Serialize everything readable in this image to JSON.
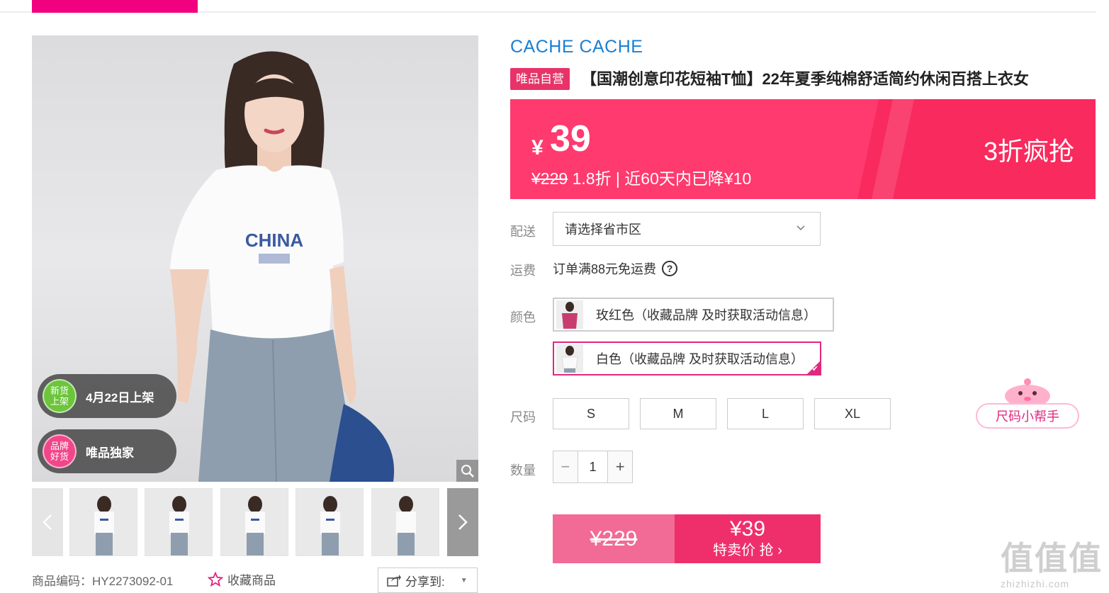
{
  "product": {
    "brand": "CACHE CACHE",
    "tag": "唯品自营",
    "title": "【国潮创意印花短袖T恤】22年夏季纯棉舒适简约休闲百搭上衣女",
    "shirt_print": "CHINA",
    "code_label": "商品编码：",
    "code": "HY2273092-01"
  },
  "badges": [
    {
      "circle": "新货上架",
      "text": "4月22日上架",
      "color": "#6cc53b"
    },
    {
      "circle": "品牌好货",
      "text": "唯品独家",
      "color": "#f2468a"
    }
  ],
  "actions": {
    "favorite": "收藏商品",
    "share": "分享到:"
  },
  "price": {
    "currency": "¥",
    "current": "39",
    "original": "¥229",
    "discount_text": "1.8折 | 近60天内已降¥10",
    "promo": "3折疯抢"
  },
  "labels": {
    "delivery": "配送",
    "freight": "运费",
    "color": "颜色",
    "size": "尺码",
    "quantity": "数量"
  },
  "delivery": {
    "placeholder": "请选择省市区",
    "freight_text": "订单满88元免运费"
  },
  "colors": [
    {
      "label": "玫红色（收藏品牌 及时获取活动信息）",
      "selected": false,
      "swatch": "#c93d6e"
    },
    {
      "label": "白色（收藏品牌 及时获取活动信息）",
      "selected": true,
      "swatch": "#f7f7f7"
    }
  ],
  "sizes": [
    "S",
    "M",
    "L",
    "XL"
  ],
  "size_helper": "尺码小帮手",
  "quantity": "1",
  "buy": {
    "original": "¥229",
    "price": "¥39",
    "action": "特卖价 抢 ›"
  },
  "watermark": {
    "chars": "值值值",
    "url": "zhizhizhi.com"
  }
}
